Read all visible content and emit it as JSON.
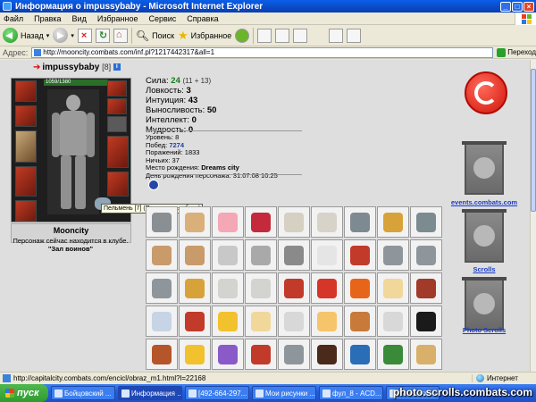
{
  "window": {
    "title": "Информация о impussybaby - Microsoft Internet Explorer",
    "min": "_",
    "max": "□",
    "close": "×"
  },
  "menu": [
    "Файл",
    "Правка",
    "Вид",
    "Избранное",
    "Сервис",
    "Справка"
  ],
  "toolbar": {
    "back": "Назад",
    "search": "Поиск",
    "favorites": "Избранное"
  },
  "address": {
    "label": "Адрес:",
    "url": "http://mooncity.combats.com/inf.pl?1217442317&all=1",
    "go": "Переход"
  },
  "character": {
    "name": "impussybaby",
    "level": "[8]",
    "info_badge": "i",
    "hp": "1059/1380",
    "tooltip": "Пельмень [7] (Посмотреть образ)",
    "city": "Mooncity",
    "location_line": "Персонаж сейчас находится в клубе.",
    "location_place": "\"Зал воинов\""
  },
  "stats": {
    "strength_label": "Сила:",
    "strength_value": "24",
    "strength_extra": "(11 + 13)",
    "agility_label": "Ловкость:",
    "agility_value": "3",
    "intuition_label": "Интуиция:",
    "intuition_value": "43",
    "stamina_label": "Выносливость:",
    "stamina_value": "50",
    "intellect_label": "Интеллект:",
    "intellect_value": "0",
    "wisdom_label": "Мудрость:",
    "wisdom_value": "0"
  },
  "details": {
    "level_label": "Уровень:",
    "level_value": "8",
    "wins_label": "Побед:",
    "wins_value": "7274",
    "losses_label": "Поражений:",
    "losses_value": "1833",
    "draws_label": "Ничьих:",
    "draws_value": "37",
    "birthplace_label": "Место рождения:",
    "birthplace_value": "Dreams city",
    "birthday_label": "День рождения персонажа:",
    "birthday_value": "31.07.08 10:25"
  },
  "right_links": {
    "events": "events.combats.com",
    "scrolls": "Scrolls",
    "photo": "Photo Scrolls"
  },
  "status": {
    "url": "http://capitalcity.combats.com/encicl/obraz_m1.html?l=22168",
    "zone": "Интернет"
  },
  "taskbar": {
    "start": "пуск",
    "tasks": [
      "Бойцовский ...",
      "Информация ...",
      "[492-664-297...",
      "Мои рисунки ...",
      "фул_8 - ACD...",
      "Безымянный..."
    ]
  },
  "watermark": "photo.scrolls.combats.com",
  "colors": {
    "item_art": [
      "#8a8f94",
      "#d9b07a",
      "#f4a7b5",
      "#c52a3c",
      "#d6d0c3",
      "#d8d3c8",
      "#7d8a91",
      "#d8a23a",
      "#7c8b90",
      "#c99a6a",
      "#c99a6a",
      "#c8c8c8",
      "#a9a9a9",
      "#8a8a8a",
      "#e5e5e5",
      "#c23a2a",
      "#8e969c",
      "#8e969c",
      "#8e969c",
      "#d8a23a",
      "#d3d3cf",
      "#d3d3cf",
      "#c23a2a",
      "#d6352a",
      "#e7651a",
      "#f1d79a",
      "#a23a2a",
      "#c6d4e6",
      "#c23a2a",
      "#f2c12e",
      "#f1d79a",
      "#d8d8d8",
      "#f6c46a",
      "#c77a3a",
      "#d8d8d8",
      "#1a1a1a",
      "#b5552a",
      "#f2c12e",
      "#8a5ac8",
      "#c23a2a",
      "#8e969c",
      "#4a2a1a",
      "#2a6eb8",
      "#3a8a3a",
      "#d8b06a"
    ]
  }
}
